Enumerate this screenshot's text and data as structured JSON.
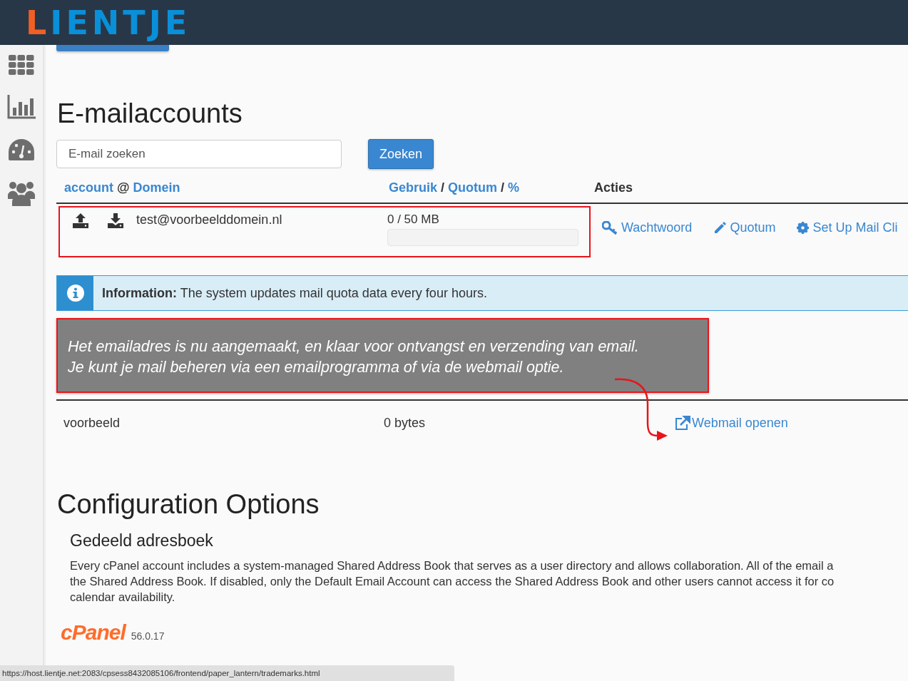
{
  "header": {
    "logo": "LIENTJE"
  },
  "sidebar": {
    "items": [
      {
        "kind": "grid"
      },
      {
        "kind": "chart"
      },
      {
        "kind": "gauge"
      },
      {
        "kind": "users"
      }
    ]
  },
  "page_title": "E-mailaccounts",
  "search": {
    "placeholder": "E-mail zoeken",
    "button": "Zoeken"
  },
  "table": {
    "columns": [
      {
        "parts": [
          {
            "text": "account",
            "link": true
          },
          {
            "text": "@",
            "link": false
          },
          {
            "text": "Domein",
            "link": true
          }
        ]
      },
      {
        "parts": [
          {
            "text": "Gebruik",
            "link": true
          },
          {
            "text": "/",
            "link": false
          },
          {
            "text": "Quotum",
            "link": true
          },
          {
            "text": "/",
            "link": false
          },
          {
            "text": "%",
            "link": true
          }
        ]
      },
      {
        "parts": [
          {
            "text": "Acties",
            "link": false
          }
        ]
      }
    ],
    "rows": [
      {
        "account": "test@voorbeelddomein.nl",
        "usage": "0 / 50 MB",
        "level": 0,
        "highlighted": true,
        "actions": [
          {
            "kind": "key",
            "label": "Wachtwoord"
          },
          {
            "kind": "pencil",
            "label": "Quotum"
          },
          {
            "kind": "gear",
            "label": "Set Up Mail Cli"
          }
        ]
      }
    ]
  },
  "info": {
    "label": "Information:",
    "text": "The system updates mail quota data every four hours."
  },
  "annotation": {
    "lines": [
      "Het emailadres is nu aangemaakt, en klaar voor ontvangst en verzending van email.",
      "Je kunt je mail beheren via een emailprogramma of via de webmail optie."
    ]
  },
  "default_account": {
    "name": "voorbeeld",
    "usage": "0 bytes",
    "link": "Webmail openen"
  },
  "config": {
    "title": "Configuration Options",
    "subtitle": "Gedeeld adresboek",
    "lines": [
      "Every cPanel account includes a system-managed Shared Address Book that serves as a user directory and allows collaboration. All of the email a",
      "the Shared Address Book. If disabled, only the Default Email Account can access the Shared Address Book and other users cannot access it for co",
      "calendar availability."
    ]
  },
  "footer": {
    "logo": "cPanel",
    "version": "56.0.17"
  },
  "status_bar": "https://host.lientje.net:2083/cpsess8432085106/frontend/paper_lantern/trademarks.html"
}
